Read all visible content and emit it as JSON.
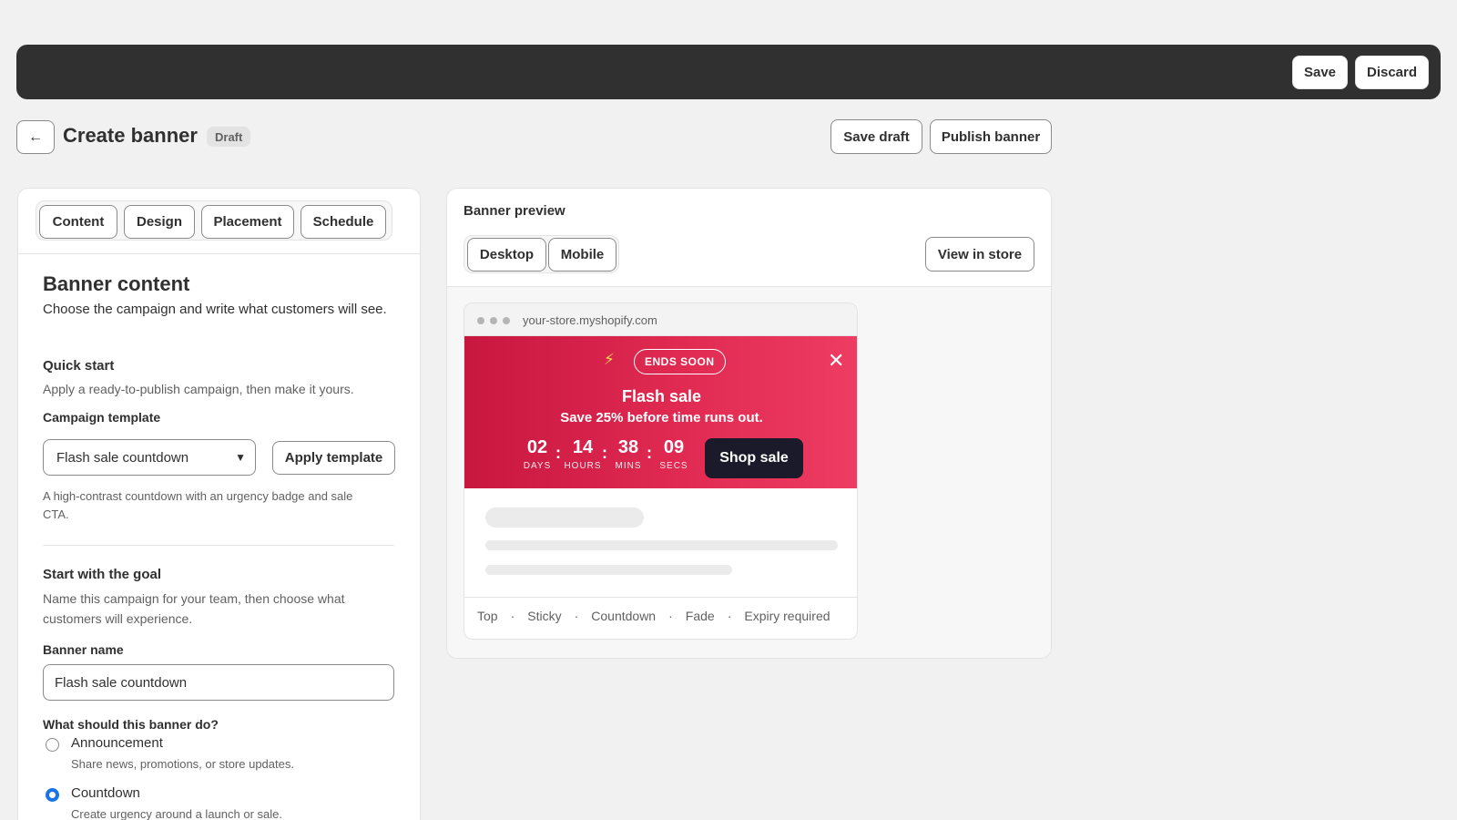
{
  "topbar": {
    "save_label": "Save",
    "discard_label": "Discard"
  },
  "header": {
    "back_icon": "←",
    "title": "Create banner",
    "badge": "Draft",
    "save_draft_label": "Save draft",
    "publish_label": "Publish banner"
  },
  "tabs": [
    {
      "label": "Content"
    },
    {
      "label": "Design"
    },
    {
      "label": "Placement"
    },
    {
      "label": "Schedule"
    }
  ],
  "content": {
    "heading": "Banner content",
    "description": "Choose the campaign and write what customers will see.",
    "quick_start_title": "Quick start",
    "quick_start_help": "Apply a ready-to-publish campaign, then make it yours.",
    "template_label": "Campaign template",
    "template_value": "Flash sale countdown",
    "apply_label": "Apply template",
    "template_help": "A high-contrast countdown with an urgency badge and sale CTA.",
    "goal_title": "Start with the goal",
    "goal_help": "Name this campaign for your team, then choose what customers will experience.",
    "name_label": "Banner name",
    "name_value": "Flash sale countdown",
    "purpose_label": "What should this banner do?",
    "options": [
      {
        "label": "Announcement",
        "help": "Share news, promotions, or store updates.",
        "checked": false
      },
      {
        "label": "Countdown",
        "help": "Create urgency around a launch or sale.",
        "checked": true
      }
    ]
  },
  "preview": {
    "title": "Banner preview",
    "device_tabs": [
      "Desktop",
      "Mobile"
    ],
    "view_store_label": "View in store",
    "url": "your-store.myshopify.com",
    "banner": {
      "badge": "ENDS SOON",
      "title": "Flash sale",
      "subtitle": "Save 25% before time runs out.",
      "countdown": [
        {
          "value": "02",
          "unit": "DAYS"
        },
        {
          "value": "14",
          "unit": "HOURS"
        },
        {
          "value": "38",
          "unit": "MINS"
        },
        {
          "value": "09",
          "unit": "SECS"
        }
      ],
      "separator": ":",
      "cta_label": "Shop sale",
      "bolt_icon": "⚡",
      "close_icon": "✕"
    },
    "footer_tags": [
      "Top",
      "Sticky",
      "Countdown",
      "Fade",
      "Expiry required"
    ],
    "footer_separator": "·"
  },
  "colors": {
    "banner_start": "#c8173f",
    "banner_end": "#ee3c62",
    "cta_bg": "#1a1a2a",
    "radio_checked": "#1a73e8",
    "topbar_bg": "#303030"
  }
}
